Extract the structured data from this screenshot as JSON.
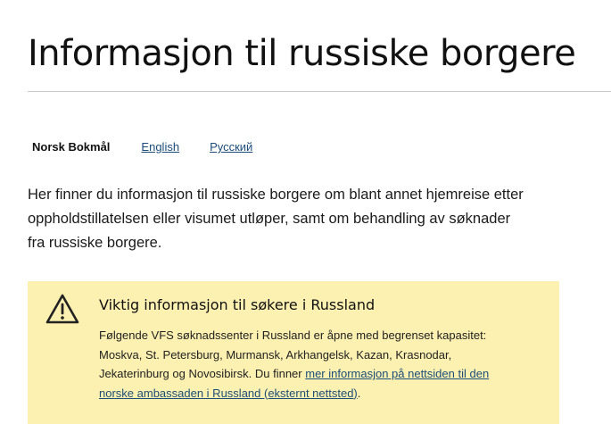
{
  "page": {
    "title": "Informasjon til russiske borgere"
  },
  "languages": {
    "current": "Norsk Bokmål",
    "links": [
      "English",
      "Русский"
    ]
  },
  "intro": {
    "text": "Her finner du informasjon til russiske borgere om blant annet hjemreise etter oppholdstillatelsen eller visumet utløper, samt om behandling av søknader fra russiske borgere."
  },
  "alert": {
    "icon": "warning-icon",
    "title": "Viktig informasjon til søkere i Russland",
    "body": "Følgende VFS søknadssenter i Russland er åpne med begrenset kapasitet: Moskva, St. Petersburg, Murmansk, Arkhangelsk, Kazan, Krasnodar, Jekaterinburg og Novosibirsk. Du finner ",
    "link_text": "mer informasjon på nettsiden til den norske ambassaden i Russland (eksternt nettsted)",
    "after_link": ".",
    "background_color": "#fcf1b0"
  },
  "colors": {
    "link": "#1c4d7a",
    "text": "#1a1a1a"
  }
}
